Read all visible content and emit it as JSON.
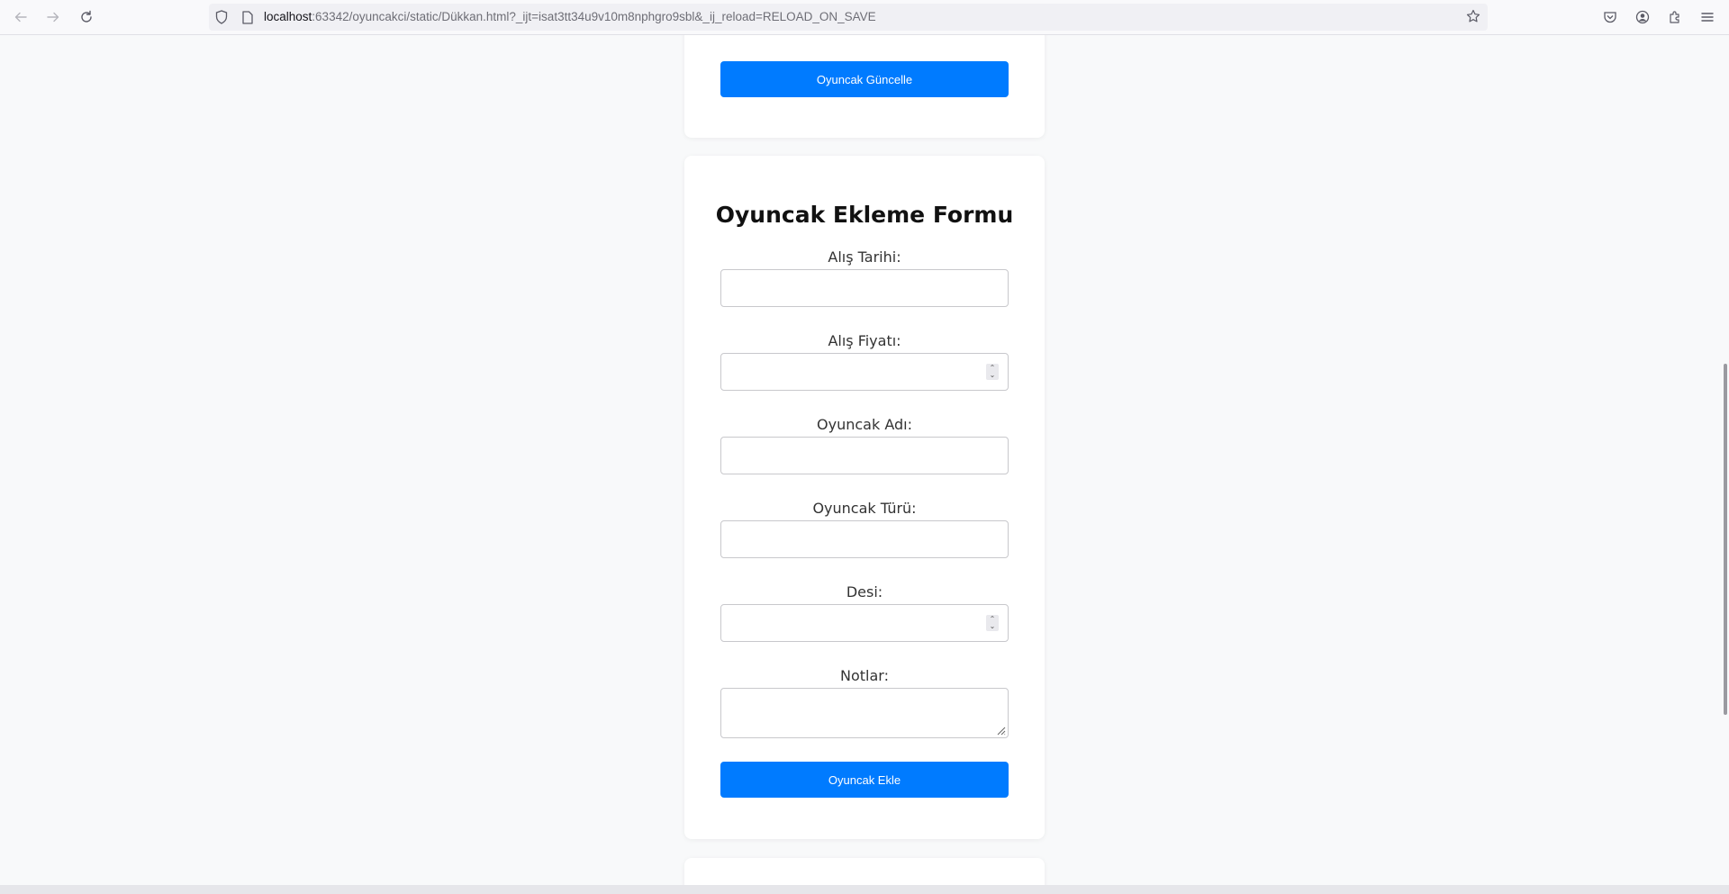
{
  "browser": {
    "url_host": "localhost",
    "url_rest": ":63342/oyuncakci/static/Dükkan.html?_ijt=isat3tt34u9v10m8nphgro9sbl&_ij_reload=RELOAD_ON_SAVE",
    "icons": {
      "back": "arrow-left-icon",
      "forward": "arrow-right-icon",
      "reload": "reload-icon",
      "shield": "shield-icon",
      "page": "page-icon",
      "bookmark": "star-icon",
      "pocket": "pocket-icon",
      "account": "account-icon",
      "extensions": "puzzle-icon",
      "menu": "hamburger-menu-icon"
    }
  },
  "update_card": {
    "button_label": "Oyuncak Güncelle"
  },
  "add_form": {
    "title": "Oyuncak Ekleme Formu",
    "fields": [
      {
        "label": "Alış Tarihi:",
        "value": "",
        "type": "text"
      },
      {
        "label": "Alış Fiyatı:",
        "value": "",
        "type": "number"
      },
      {
        "label": "Oyuncak Adı:",
        "value": "",
        "type": "text"
      },
      {
        "label": "Oyuncak Türü:",
        "value": "",
        "type": "text"
      },
      {
        "label": "Desi:",
        "value": "",
        "type": "number"
      },
      {
        "label": "Notlar:",
        "value": "",
        "type": "textarea"
      }
    ],
    "submit_label": "Oyuncak Ekle"
  },
  "colors": {
    "accent": "#007bff",
    "page_bg": "#f8f9fa",
    "card_bg": "#ffffff"
  }
}
